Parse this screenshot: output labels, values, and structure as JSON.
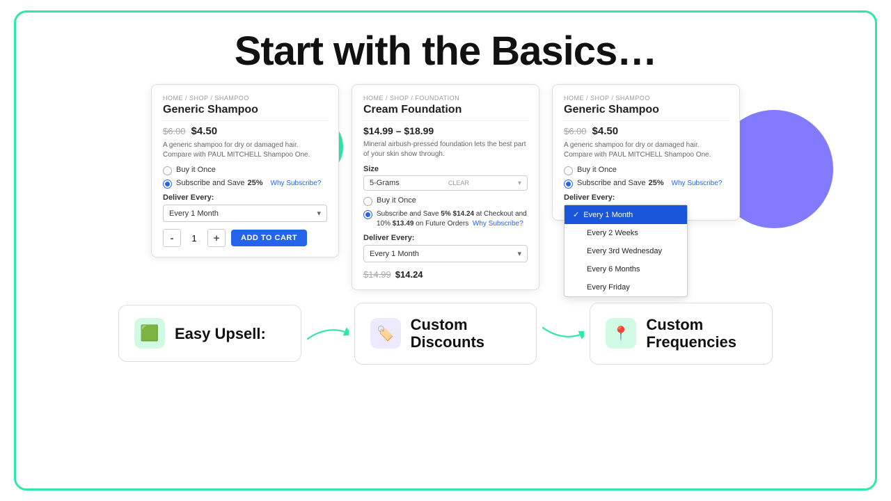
{
  "headline": "Start with the Basics…",
  "cards": [
    {
      "id": "card1",
      "breadcrumb": "HOME / SHOP / SHAMPOO",
      "title": "Generic Shampoo",
      "price_old": "$6.00",
      "price_new": "$4.50",
      "description": "A generic shampoo for dry or damaged hair. Compare with PAUL MITCHELL Shampoo One.",
      "options": [
        {
          "label": "Buy it Once",
          "checked": false
        },
        {
          "label": "Subscribe and Save ",
          "save_pct": "25%",
          "why": "Why Subscribe?",
          "checked": true
        }
      ],
      "deliver_label": "Deliver Every:",
      "deliver_value": "Every 1 Month",
      "qty": 1,
      "add_to_cart": "ADD TO CART"
    },
    {
      "id": "card2",
      "breadcrumb": "HOME / SHOP / FOUNDATION",
      "title": "Cream Foundation",
      "price_range": "$14.99 – $18.99",
      "description": "Mineral airbush-pressed foundation lets the best part of your skin show through.",
      "size_label": "Size",
      "size_value": "5-Grams",
      "size_clear": "CLEAR",
      "options": [
        {
          "label": "Buy it Once",
          "checked": false
        },
        {
          "label": "Subscribe and Save ",
          "save_pct": "5%",
          "detail": "$14.24 at Checkout and 10% $13.49 on Future Orders",
          "why": "Why Subscribe?",
          "checked": true
        }
      ],
      "deliver_label": "Deliver Every:",
      "deliver_value": "Every 1 Month",
      "price_strike": "$14.99",
      "price_final": "$14.24"
    },
    {
      "id": "card3",
      "breadcrumb": "HOME / SHOP / SHAMPOO",
      "title": "Generic Shampoo",
      "price_old": "$6.00",
      "price_new": "$4.50",
      "description": "A generic shampoo for dry or damaged hair. Compare with PAUL MITCHELL Shampoo One.",
      "options": [
        {
          "label": "Buy it Once",
          "checked": false
        },
        {
          "label": "Subscribe and Save ",
          "save_pct": "25%",
          "why": "Why Subscribe?",
          "checked": true
        }
      ],
      "deliver_label": "Deliver Every:",
      "dropdown_open": true,
      "dropdown_items": [
        {
          "label": "Every 1 Month",
          "active": true
        },
        {
          "label": "Every 2 Weeks",
          "active": false
        },
        {
          "label": "Every 3rd Wednesday",
          "active": false
        },
        {
          "label": "Every 6 Months",
          "active": false
        },
        {
          "label": "Every Friday",
          "active": false
        }
      ]
    }
  ],
  "features": [
    {
      "id": "feat1",
      "icon": "🟩",
      "icon_type": "teal",
      "label": "Easy Upsell:"
    },
    {
      "id": "feat2",
      "icon": "🏷",
      "icon_type": "purple",
      "label": "Custom\nDiscounts"
    },
    {
      "id": "feat3",
      "icon": "📍",
      "icon_type": "green",
      "label": "Custom\nFrequencies"
    }
  ]
}
